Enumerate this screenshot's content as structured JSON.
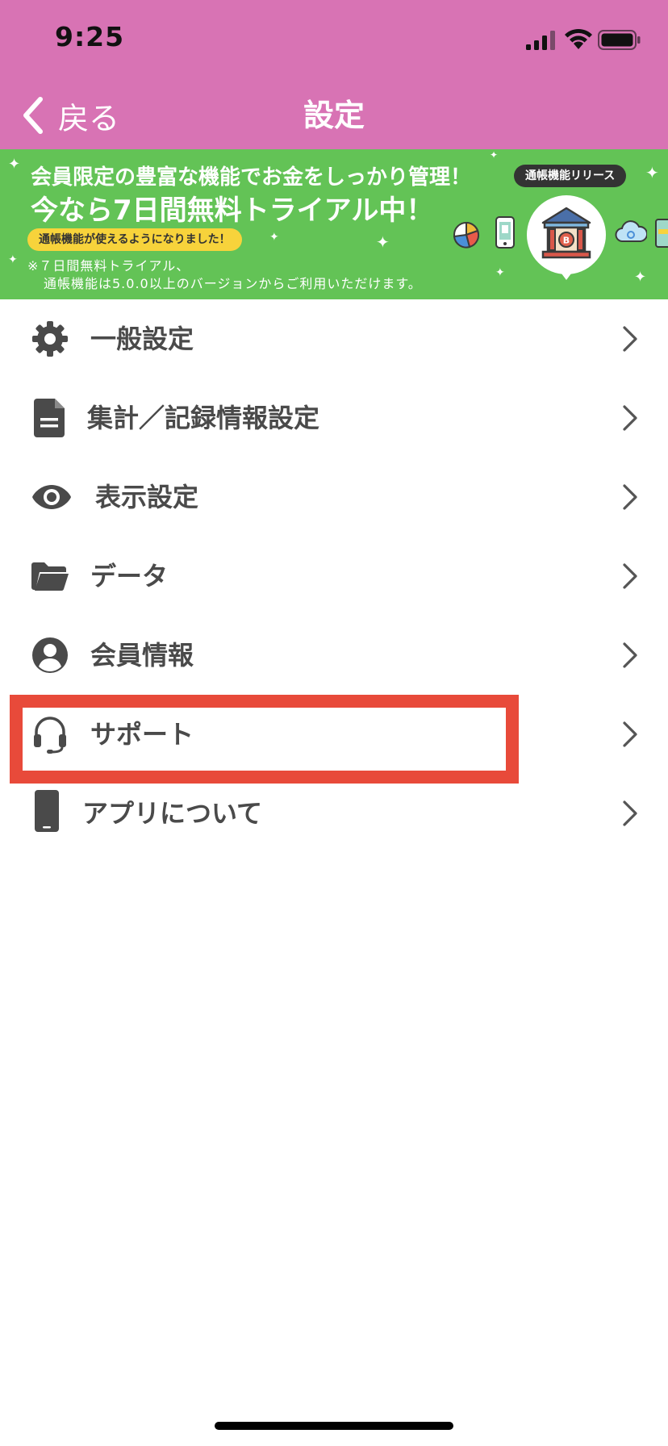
{
  "status_bar": {
    "time": "9:25"
  },
  "nav": {
    "back_label": "戻る",
    "title": "設定"
  },
  "banner": {
    "headline1": "会員限定の豊富な機能でお金をしっかり管理！",
    "headline2": "今なら7日間無料トライアル中！",
    "pill": "通帳機能が使えるようになりました！",
    "note1": "※７日間無料トライアル、",
    "note2": "通帳機能は5.0.0以上のバージョンからご利用いただけます。",
    "release_badge": "通帳機能リリース",
    "bank_letter": "B",
    "background": "#63c356"
  },
  "settings": {
    "items": [
      {
        "label": "一般設定",
        "icon": "gear-icon"
      },
      {
        "label": "集計／記録情報設定",
        "icon": "document-icon"
      },
      {
        "label": "表示設定",
        "icon": "eye-icon"
      },
      {
        "label": "データ",
        "icon": "folder-icon"
      },
      {
        "label": "会員情報",
        "icon": "user-circle-icon"
      },
      {
        "label": "サポート",
        "icon": "headset-icon"
      },
      {
        "label": "アプリについて",
        "icon": "smartphone-icon"
      }
    ],
    "highlighted_item": "サポート"
  },
  "colors": {
    "header": "#d873b4",
    "highlight": "#e84a3a",
    "icon": "#4a4a4a",
    "text": "#4a4a4a"
  }
}
